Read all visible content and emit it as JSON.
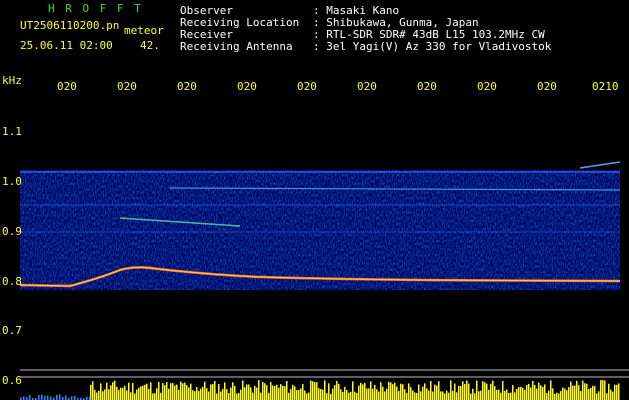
{
  "header": {
    "station": "H R O F F T",
    "filename": "UT2506110200.pn",
    "mode": "meteor",
    "date_time": "25.06.11 02:00",
    "count": "42.",
    "info_labels": [
      "Observer",
      "Receiving Location",
      "Receiver",
      "Receiving Antenna"
    ],
    "info_values": [
      ": Masaki Kano",
      ": Shibukawa, Gunma, Japan",
      ": RTL-SDR SDR# 43dB L15 103.2MHz CW",
      ": 3el Yagi(V) Az 330 for Vladivostok"
    ]
  },
  "axis": {
    "unit": "kHz",
    "y_ticks": [
      "1.1",
      "1.0",
      "0.9",
      "0.8",
      "0.7",
      "0.6"
    ],
    "x_ticks": [
      "020",
      "020",
      "020",
      "020",
      "020",
      "020",
      "020",
      "020",
      "020",
      "0210"
    ]
  },
  "colors": {
    "background": "#000000",
    "spectrum_bg": "#000080",
    "label_yellow": "#ffff33",
    "header_green": "#33dd33",
    "activity_bars": "#ffff00"
  }
}
